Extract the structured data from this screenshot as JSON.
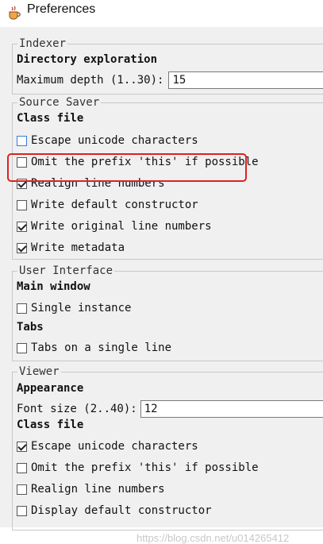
{
  "window": {
    "title": "Preferences",
    "icon": "coffee-cup-icon"
  },
  "indexer": {
    "legend": "Indexer",
    "section_title": "Directory exploration",
    "max_depth_label": "Maximum depth (1..30):",
    "max_depth_value": "15"
  },
  "source_saver": {
    "legend": "Source Saver",
    "section_title": "Class file",
    "options": [
      {
        "label": "Escape unicode characters",
        "checked": false
      },
      {
        "label": "Omit the prefix 'this' if possible",
        "checked": false
      },
      {
        "label": "Realign line numbers",
        "checked": true
      },
      {
        "label": "Write default constructor",
        "checked": false
      },
      {
        "label": "Write original line numbers",
        "checked": true
      },
      {
        "label": "Write metadata",
        "checked": true
      }
    ]
  },
  "user_interface": {
    "legend": "User Interface",
    "main_window_title": "Main window",
    "single_instance": {
      "label": "Single instance",
      "checked": false
    },
    "tabs_title": "Tabs",
    "tabs_single_line": {
      "label": "Tabs on a single line",
      "checked": false
    }
  },
  "viewer": {
    "legend": "Viewer",
    "appearance_title": "Appearance",
    "font_size_label": "Font size (2..40):",
    "font_size_value": "12",
    "class_file_title": "Class file",
    "options": [
      {
        "label": "Escape unicode characters",
        "checked": true
      },
      {
        "label": "Omit the prefix 'this' if possible",
        "checked": false
      },
      {
        "label": "Realign line numbers",
        "checked": false
      },
      {
        "label": "Display default constructor",
        "checked": false
      }
    ]
  },
  "watermark": "https://blog.csdn.net/u014265412",
  "colors": {
    "highlight": "#e02020",
    "panel_bg": "#f0f0f0",
    "title_bg": "#ffffff"
  }
}
